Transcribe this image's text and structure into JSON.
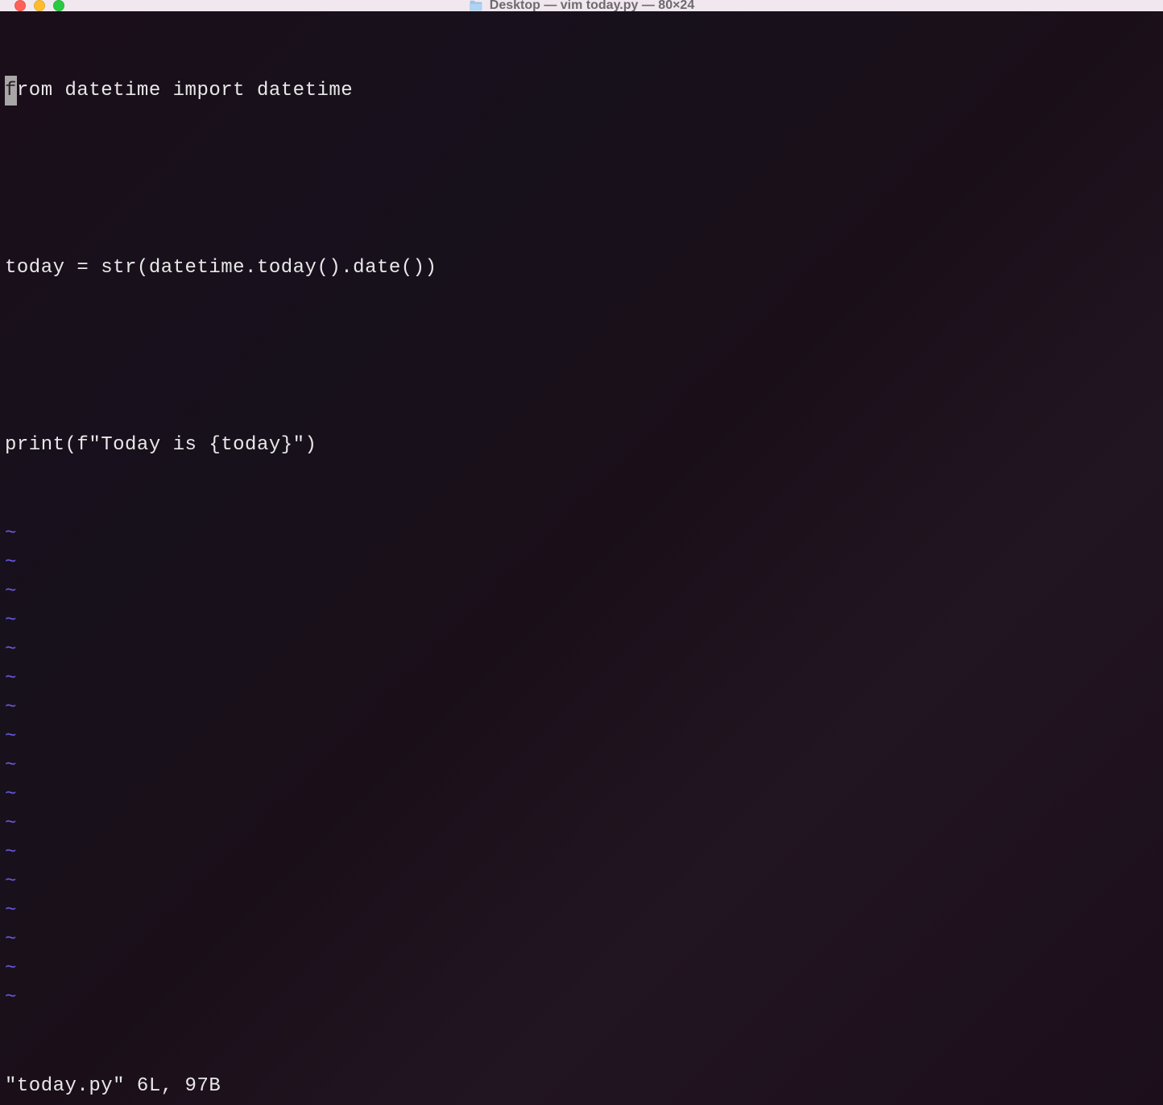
{
  "window": {
    "title": "Desktop — vim today.py — 80×24"
  },
  "editor": {
    "cursor_char": "f",
    "line1_rest": "rom datetime import datetime",
    "line2": "",
    "line3": "today = str(datetime.today().date())",
    "line4": "",
    "line5": "print(f\"Today is {today}\")",
    "tilde_char": "~",
    "tilde_count": 17
  },
  "status": {
    "text": "\"today.py\" 6L, 97B"
  }
}
